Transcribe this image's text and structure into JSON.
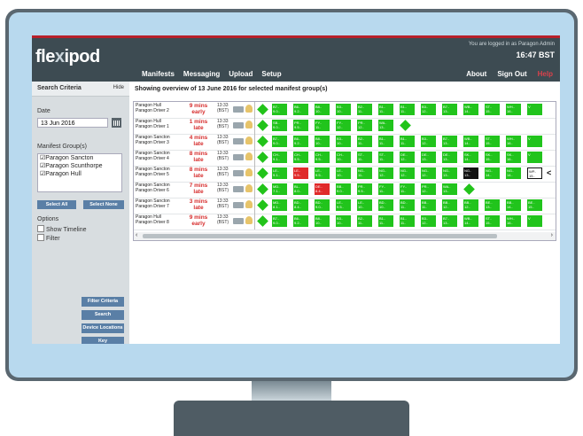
{
  "app": {
    "logo_text_a": "fle",
    "logo_text_b": "x",
    "logo_text_c": "ipod",
    "login_info": "You are logged in as Paragon Admin",
    "clock": "16:47 BST"
  },
  "nav": {
    "left": [
      "Manifests",
      "Messaging",
      "Upload",
      "Setup"
    ],
    "right": [
      "About",
      "Sign Out",
      "Help"
    ]
  },
  "sidebar": {
    "title": "Search Criteria",
    "hide": "Hide",
    "date_label": "Date",
    "date_value": "13 Jun 2016",
    "groups_label": "Manifest Group(s)",
    "groups": [
      "☑Paragon Sancton",
      "☑Paragon Scunthorpe",
      "☑Paragon Hull"
    ],
    "select_all": "Select All",
    "select_none": "Select None",
    "options_label": "Options",
    "options": [
      "Show Timeline",
      "Filter"
    ],
    "buttons": [
      "Filter Criteria",
      "Search",
      "Device Locations",
      "Key"
    ]
  },
  "main": {
    "title": "Showing overview of 13 June 2016 for selected manifest group(s)"
  },
  "rows": [
    {
      "name": "Paragon Hull\nParagon Driver 2",
      "status": "9 mins\nearly",
      "time": "13:33\n(BST)",
      "stops": [
        [
          "B7..",
          "9.0.."
        ],
        [
          "B6..",
          "9.2.."
        ],
        [
          "B8..",
          "10.."
        ],
        [
          "B3..",
          "10.."
        ],
        [
          "B2..",
          "11.."
        ],
        [
          "B1..",
          "11.."
        ],
        [
          "B1..",
          "11.."
        ],
        [
          "B3..",
          "12.."
        ],
        [
          "B7..",
          "13.."
        ],
        [
          "WB..",
          "14.."
        ],
        [
          "ST..",
          "15.."
        ],
        [
          "WH..",
          "16.."
        ],
        [
          "V",
          ""
        ]
      ],
      "colors": [
        "g",
        "g",
        "g",
        "g",
        "g",
        "g",
        "g",
        "g",
        "g",
        "g",
        "g",
        "g",
        "g"
      ],
      "end": ""
    },
    {
      "name": "Paragon Hull\nParagon Driver 1",
      "status": "1 mins\nlate",
      "time": "13:33\n(BST)",
      "stops": [
        [
          "SB..",
          "9.0.."
        ],
        [
          "PR..",
          "9.5.."
        ],
        [
          "FY..",
          "11.."
        ],
        [
          "FY..",
          "12.."
        ],
        [
          "PR..",
          "12.."
        ],
        [
          "WA..",
          "13.."
        ]
      ],
      "colors": [
        "g",
        "g",
        "g",
        "g",
        "g",
        "g"
      ],
      "end": "diamond"
    },
    {
      "name": "Paragon Sancton\nParagon Driver 3",
      "status": "4 mins\nlate",
      "time": "13:33\n(BST)",
      "stops": [
        [
          "B7..",
          "9.0.."
        ],
        [
          "B6..",
          "9.2.."
        ],
        [
          "B8..",
          "10.."
        ],
        [
          "B3..",
          "10.."
        ],
        [
          "B2..",
          "11.."
        ],
        [
          "B1..",
          "11.."
        ],
        [
          "B1..",
          "11.."
        ],
        [
          "B3..",
          "12.."
        ],
        [
          "B7..",
          "13.."
        ],
        [
          "WB..",
          "14.."
        ],
        [
          "ST..",
          "15.."
        ],
        [
          "WH..",
          "16.."
        ],
        [
          "V",
          ""
        ]
      ],
      "colors": [
        "g",
        "g",
        "g",
        "g",
        "g",
        "g",
        "g",
        "g",
        "g",
        "g",
        "g",
        "g",
        "g"
      ],
      "end": ""
    },
    {
      "name": "Paragon Sancton\nParagon Driver 4",
      "status": "8 mins\nlate",
      "time": "13:33\n(BST)",
      "stops": [
        [
          "CH..",
          "9.1.."
        ],
        [
          "CH..",
          "9.5.."
        ],
        [
          "CH..",
          "9.5.."
        ],
        [
          "CH..",
          "10.."
        ],
        [
          "ST..",
          "11.."
        ],
        [
          "ST..",
          "11.."
        ],
        [
          "DE..",
          "12.."
        ],
        [
          "DE..",
          "13.."
        ],
        [
          "DE..",
          "13.."
        ],
        [
          "SK..",
          "14.."
        ],
        [
          "SK..",
          "15.."
        ],
        [
          "SK..",
          "16.."
        ],
        [
          "V",
          ""
        ]
      ],
      "colors": [
        "g",
        "g",
        "g",
        "g",
        "g",
        "g",
        "g",
        "g",
        "g",
        "g",
        "g",
        "g",
        "g"
      ],
      "end": ""
    },
    {
      "name": "Paragon Sancton\nParagon Driver 5",
      "status": "8 mins\nlate",
      "time": "13:33\n(BST)",
      "stops": [
        [
          "LE..",
          "9.1.."
        ],
        [
          "LE..",
          "9.5.."
        ],
        [
          "LE..",
          "9.5.."
        ],
        [
          "LE..",
          "10.."
        ],
        [
          "NG..",
          "11.."
        ],
        [
          "NG..",
          "12.."
        ],
        [
          "NG..",
          "12.."
        ],
        [
          "NG..",
          "12.."
        ],
        [
          "NG..",
          "13.."
        ],
        [
          "NG..",
          "13.."
        ],
        [
          "NG..",
          "14.."
        ],
        [
          "NG..",
          "14.."
        ],
        [
          "WP..",
          "15.."
        ]
      ],
      "colors": [
        "g",
        "r",
        "g",
        "g",
        "g",
        "g",
        "g",
        "g",
        "g",
        "k",
        "g",
        "g",
        "o"
      ],
      "end": "chevron"
    },
    {
      "name": "Paragon Sancton\nParagon Driver 6",
      "status": "7 mins\nlate",
      "time": "13:33\n(BST)",
      "stops": [
        [
          "MD..",
          "7.1.."
        ],
        [
          "BL..",
          "8.0.."
        ],
        [
          "DE..",
          "8.4.."
        ],
        [
          "BB..",
          "9.0.."
        ],
        [
          "PR..",
          "9.5.."
        ],
        [
          "FY..",
          "11.."
        ],
        [
          "FY..",
          "11.."
        ],
        [
          "PR..",
          "12.."
        ],
        [
          "WA..",
          "13.."
        ]
      ],
      "colors": [
        "g",
        "g",
        "r",
        "g",
        "g",
        "g",
        "g",
        "g",
        "g"
      ],
      "end": "diamond"
    },
    {
      "name": "Paragon Sancton\nParagon Driver 7",
      "status": "3 mins\nlate",
      "time": "13:33\n(BST)",
      "stops": [
        [
          "MD..",
          "8.1.."
        ],
        [
          "BD..",
          "8.4.."
        ],
        [
          "BD..",
          "9.0.."
        ],
        [
          "LE..",
          "9.5.."
        ],
        [
          "LE..",
          "10.."
        ],
        [
          "BD..",
          "10.."
        ],
        [
          "BD..",
          "11.."
        ],
        [
          "BB..",
          "11.."
        ],
        [
          "BB..",
          "12.."
        ],
        [
          "BB..",
          "12.."
        ],
        [
          "BE..",
          "13.."
        ],
        [
          "BB..",
          "14.."
        ],
        [
          "BE..",
          "15.."
        ]
      ],
      "colors": [
        "g",
        "g",
        "g",
        "g",
        "g",
        "g",
        "g",
        "g",
        "g",
        "g",
        "g",
        "g",
        "g"
      ],
      "end": ""
    },
    {
      "name": "Paragon Hull\nParagon Driver 8",
      "status": "9 mins\nearly",
      "time": "13:33\n(BST)",
      "stops": [
        [
          "B7..",
          "9.0.."
        ],
        [
          "B6..",
          "9.2.."
        ],
        [
          "B8..",
          "10.."
        ],
        [
          "B3..",
          "10.."
        ],
        [
          "B2..",
          "11.."
        ],
        [
          "B1..",
          "11.."
        ],
        [
          "B1..",
          "11.."
        ],
        [
          "B3..",
          "12.."
        ],
        [
          "B7..",
          "13.."
        ],
        [
          "WB..",
          "14.."
        ],
        [
          "ST..",
          "15.."
        ],
        [
          "WH..",
          "16.."
        ],
        [
          "V",
          ""
        ]
      ],
      "colors": [
        "g",
        "g",
        "g",
        "g",
        "g",
        "g",
        "g",
        "g",
        "g",
        "g",
        "g",
        "g",
        "g"
      ],
      "end": ""
    }
  ],
  "colors": {
    "accent": "#b8202a",
    "header": "#3d4b52",
    "on_time": "#21c41c",
    "late": "#e02a2a",
    "button": "#5a7fa6"
  }
}
